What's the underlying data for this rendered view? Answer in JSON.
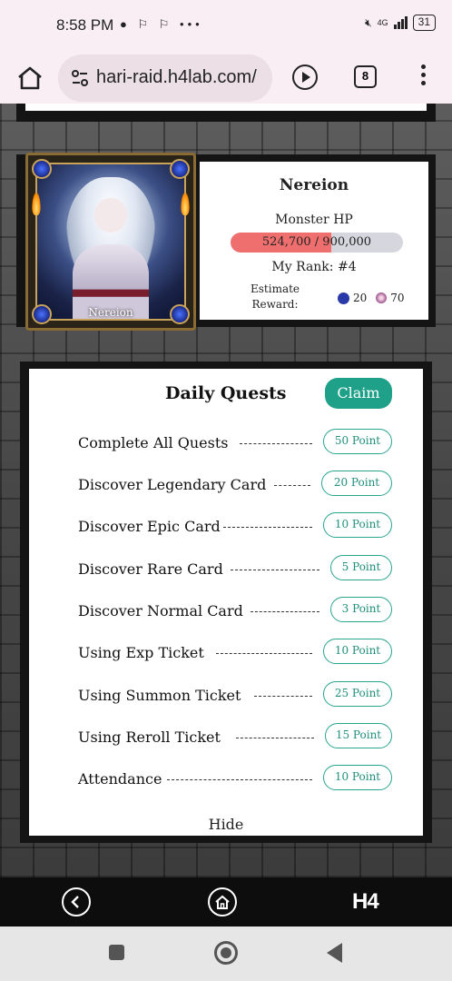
{
  "status_bar": {
    "time": "8:58 PM",
    "notification_icons": [
      "chat-bubble-icon",
      "link-icon",
      "link-icon",
      "more-icon"
    ],
    "network": "4G",
    "battery": "31"
  },
  "browser": {
    "url": "hari-raid.h4lab.com/",
    "tab_count": "8"
  },
  "boss": {
    "name": "Nereion",
    "portrait_name": "Nereion",
    "hp_label": "Monster HP",
    "hp_current": 524700,
    "hp_max": 900000,
    "hp_text": "524,700 / 900,000",
    "rank_text": "My Rank: #4",
    "reward_label_line1": "Estimate",
    "reward_label_line2": "Reward:",
    "reward_coin": "20",
    "reward_orb": "70"
  },
  "quests": {
    "title": "Daily Quests",
    "claim_label": "Claim",
    "hide_label": "Hide",
    "items": [
      {
        "label": "Complete All Quests",
        "points": "50 Point"
      },
      {
        "label": "Discover Legendary Card",
        "points": "20 Point"
      },
      {
        "label": "Discover Epic Card",
        "points": "10 Point"
      },
      {
        "label": "Discover Rare Card",
        "points": "5 Point"
      },
      {
        "label": "Discover Normal Card",
        "points": "3 Point"
      },
      {
        "label": "Using Exp Ticket",
        "points": "10 Point"
      },
      {
        "label": "Using Summon Ticket",
        "points": "25 Point"
      },
      {
        "label": "Using Reroll Ticket",
        "points": "15 Point"
      },
      {
        "label": "Attendance",
        "points": "10 Point"
      }
    ]
  },
  "bottom_nav": {
    "logo_text": "H4"
  },
  "colors": {
    "accent": "#1fa088",
    "hp_fill": "#ef6f6f",
    "hp_track": "#d6d6de"
  }
}
